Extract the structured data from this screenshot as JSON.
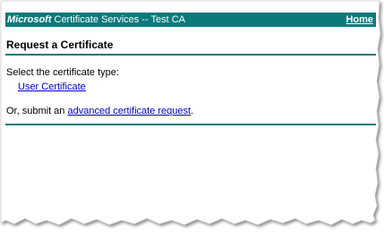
{
  "header": {
    "brand": "Microsoft",
    "title": "Certificate Services  --  Test CA",
    "home_label": "Home"
  },
  "page": {
    "title": "Request a Certificate",
    "prompt": "Select the certificate type:",
    "option_user_certificate": "User Certificate",
    "alt_prefix": "Or, submit an ",
    "alt_link": "advanced certificate request",
    "alt_suffix": "."
  },
  "colors": {
    "accent": "#0a7a7a",
    "link": "#0000cc"
  }
}
